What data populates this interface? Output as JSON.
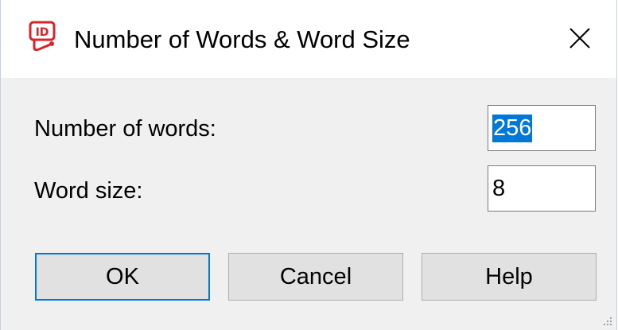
{
  "window": {
    "title": "Number of Words & Word Size",
    "icon": "app-logo-icon",
    "close_icon": "close-icon"
  },
  "form": {
    "words_label": "Number of words:",
    "words_value": "256",
    "words_selected": true,
    "size_label": "Word size:",
    "size_value": "8"
  },
  "buttons": {
    "ok_label": "OK",
    "cancel_label": "Cancel",
    "help_label": "Help"
  },
  "colors": {
    "accent": "#0078d7",
    "button_bg": "#e1e1e1",
    "dialog_bg": "#f0f0f0",
    "icon_red": "#d8232a"
  }
}
